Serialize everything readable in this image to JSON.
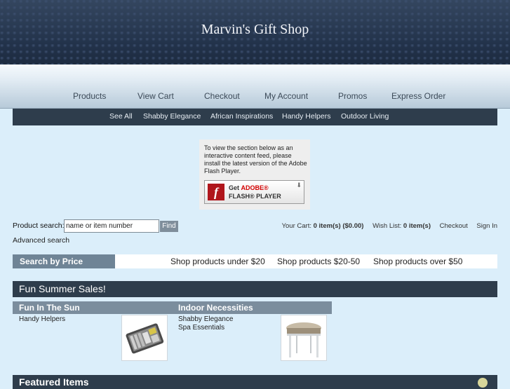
{
  "site": {
    "title": "Marvin's Gift Shop"
  },
  "main_nav": [
    "Products",
    "View Cart",
    "Checkout",
    "My Account",
    "Promos",
    "Express Order"
  ],
  "sub_nav": [
    "See All",
    "Shabby Elegance",
    "African Inspirations",
    "Handy Helpers",
    "Outdoor Living"
  ],
  "flash": {
    "message": "To view the section below as an interactive content feed, please install the latest version of the Adobe Flash Player.",
    "button_get": "Get",
    "button_brand": "ADOBE®",
    "button_product": "FLASH® PLAYER"
  },
  "search": {
    "label": "Product search:",
    "placeholder": "name or item number",
    "value": "name or item number",
    "button": "Find",
    "advanced": "Advanced search"
  },
  "cart": {
    "label": "Your Cart:",
    "items": "0 item(s)",
    "total": "($0.00)",
    "wishlist_label": "Wish List:",
    "wishlist_items": "0 item(s)",
    "checkout": "Checkout",
    "signin": "Sign In"
  },
  "price": {
    "title": "Search by Price",
    "links": [
      "Shop products under $20",
      "Shop products $20-50",
      "Shop products over $50"
    ]
  },
  "sales": {
    "title": "Fun Summer Sales!",
    "categories": [
      {
        "title": "Fun In The Sun",
        "links": [
          "Handy Helpers"
        ],
        "image": "tool-kit"
      },
      {
        "title": "Indoor Necessities",
        "links": [
          "Shabby Elegance",
          "Spa Essentials"
        ],
        "image": "upholstered-stool"
      }
    ]
  },
  "featured": {
    "title": "Featured Items"
  }
}
